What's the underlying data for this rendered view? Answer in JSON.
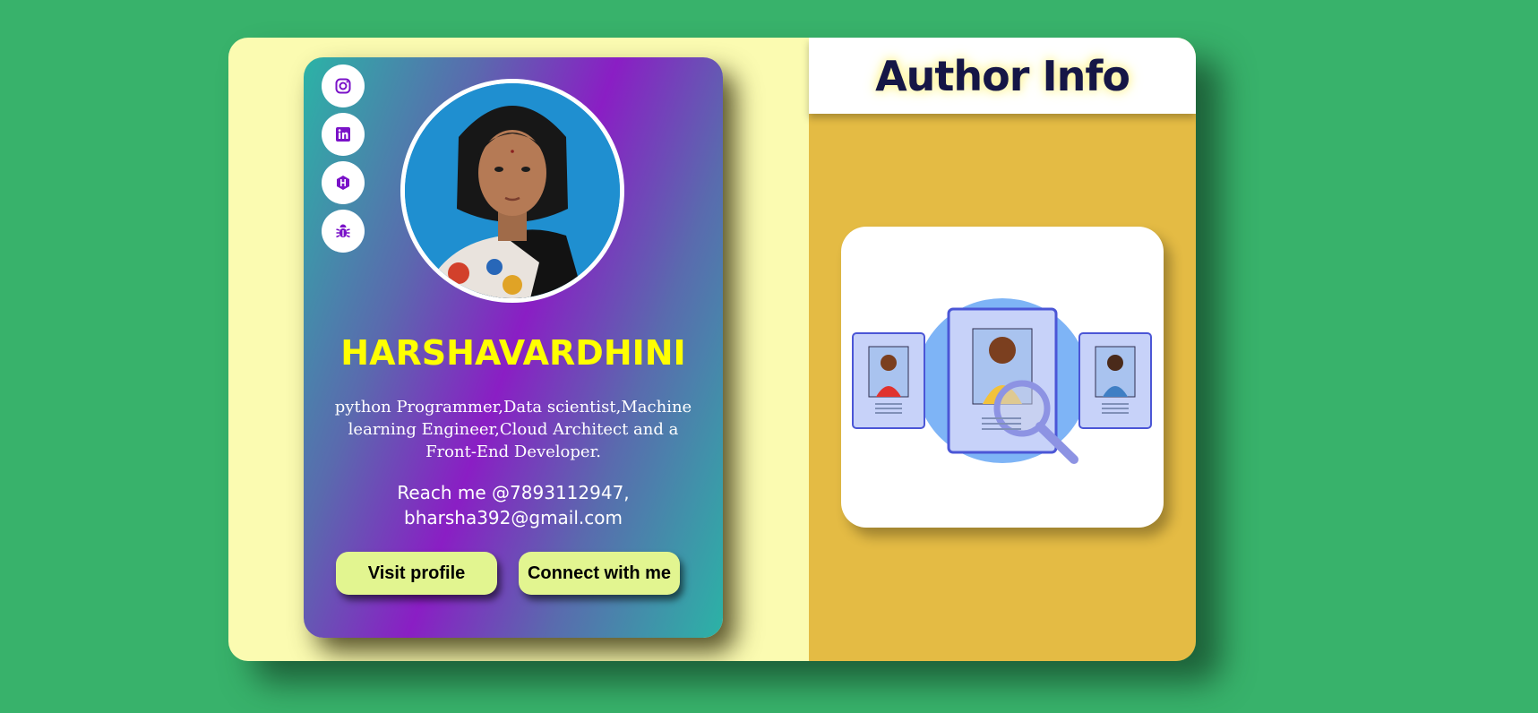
{
  "card": {
    "name": "HARSHAVARDHINI",
    "description": "python Programmer,Data scientist,Machine learning Engineer,Cloud Architect and a Front-End Developer.",
    "contact_line1": "Reach me @7893112947,",
    "contact_line2": "bharsha392@gmail.com",
    "buttons": {
      "visit": "Visit profile",
      "connect": "Connect with me"
    },
    "social_icons": [
      "instagram-icon",
      "linkedin-icon",
      "hackerrank-icon",
      "bug-icon"
    ]
  },
  "info_panel": {
    "title": "Author Info"
  },
  "colors": {
    "page_bg": "#38b26b",
    "left_panel": "#fbfbb1",
    "right_panel": "#e4bb44",
    "name": "#ffff00",
    "title": "#151646",
    "button": "#e2f590",
    "icon": "#7a12c8"
  }
}
